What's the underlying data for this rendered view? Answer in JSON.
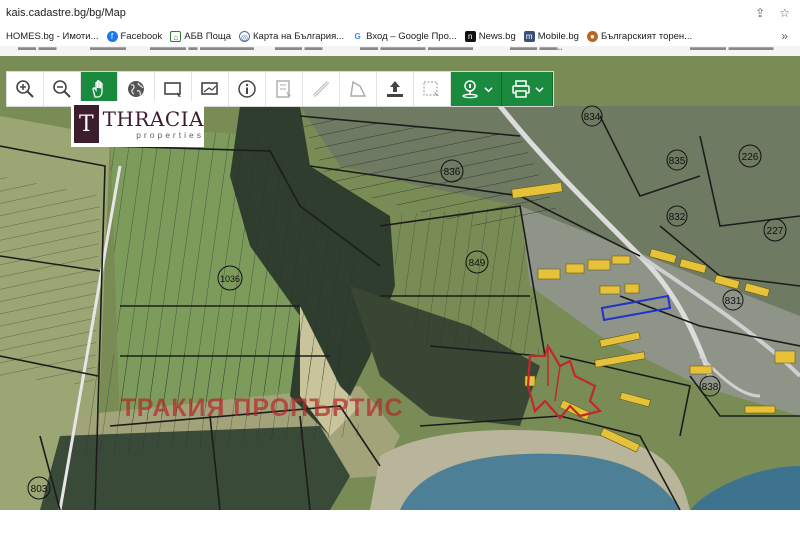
{
  "browser": {
    "url": "kais.cadastre.bg/bg/Map"
  },
  "bookmarks": [
    {
      "label": "HOMES.bg - Имоти...",
      "color": "#555555",
      "glyph": ""
    },
    {
      "label": "Facebook",
      "color": "#1877f2",
      "glyph": "f"
    },
    {
      "label": "АБВ Поща",
      "color": "#2e7d32",
      "glyph": "⌂"
    },
    {
      "label": "Карта на България...",
      "color": "#4a6fa5",
      "glyph": "◎"
    },
    {
      "label": "Вход – Google Про...",
      "color": "#4285f4",
      "glyph": "G"
    },
    {
      "label": "News.bg",
      "color": "#111111",
      "glyph": "n"
    },
    {
      "label": "Mobile.bg",
      "color": "#3a4f7a",
      "glyph": "m"
    },
    {
      "label": "Българският торен...",
      "color": "#c0631b",
      "glyph": "●"
    }
  ],
  "toolbar": {
    "buttons": [
      {
        "name": "zoom-in-button",
        "icon": "zoom-in-icon"
      },
      {
        "name": "zoom-out-button",
        "icon": "zoom-out-icon"
      },
      {
        "name": "pan-button",
        "icon": "hand-icon",
        "active": true
      },
      {
        "name": "globe-button",
        "icon": "globe-icon"
      },
      {
        "name": "select-rectangle-button",
        "icon": "rectangle-icon"
      },
      {
        "name": "select-area-button",
        "icon": "area-select-icon"
      },
      {
        "name": "info-button",
        "icon": "info-icon"
      },
      {
        "name": "layers-button",
        "icon": "layers-icon"
      },
      {
        "name": "measure-line-button",
        "icon": "ruler-icon"
      },
      {
        "name": "measure-area-button",
        "icon": "polygon-icon"
      },
      {
        "name": "upload-button",
        "icon": "upload-icon"
      },
      {
        "name": "clear-selection-button",
        "icon": "clear-selection-icon"
      },
      {
        "name": "location-dropdown-button",
        "icon": "location-icon"
      },
      {
        "name": "print-dropdown-button",
        "icon": "print-icon"
      }
    ]
  },
  "logo": {
    "mark": "T",
    "brand": "THRACIA",
    "sub": "properties"
  },
  "map": {
    "watermark": "ТРАКИЯ ПРОПЪРТИС",
    "parcel_labels": [
      "834",
      "835",
      "226",
      "227",
      "832",
      "831",
      "836",
      "849",
      "838",
      "1036",
      "803"
    ]
  }
}
